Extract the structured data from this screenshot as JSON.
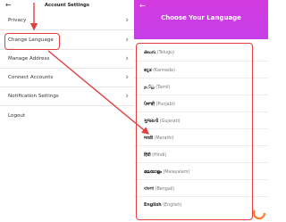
{
  "left": {
    "title": "Account Settings",
    "back_icon": "arrow-left-icon",
    "menu": [
      {
        "label": "Privacy",
        "chevron": true
      },
      {
        "label": "Change Language",
        "chevron": true
      },
      {
        "label": "Manage Address",
        "chevron": true
      },
      {
        "label": "Connect Accounts",
        "chevron": true
      },
      {
        "label": "Notification Settings",
        "chevron": true
      },
      {
        "label": "Logout",
        "chevron": false
      }
    ]
  },
  "right": {
    "title": "Choose Your Language",
    "back_icon": "arrow-left-icon",
    "languages": [
      {
        "native": "తెలుగు",
        "english": "(Telugu)"
      },
      {
        "native": "ಕನ್ನಡ",
        "english": "(Kannada)"
      },
      {
        "native": "தமிழ்",
        "english": "(Tamil)"
      },
      {
        "native": "ਪੰਜਾਬੀ",
        "english": "(Punjabi)"
      },
      {
        "native": "ગુજરાતી",
        "english": "(Gujarati)"
      },
      {
        "native": "मराठी",
        "english": "(Marathi)"
      },
      {
        "native": "हिंदी",
        "english": "(Hindi)"
      },
      {
        "native": "മലയാളം",
        "english": "(Malayalam)"
      },
      {
        "native": "বাংলা",
        "english": "(Bengali)"
      },
      {
        "native": "English",
        "english": "(English)"
      }
    ]
  },
  "colors": {
    "highlight": "#e04040",
    "gradient_top": "#d33be0",
    "gradient_bottom": "#8e5bf3"
  }
}
